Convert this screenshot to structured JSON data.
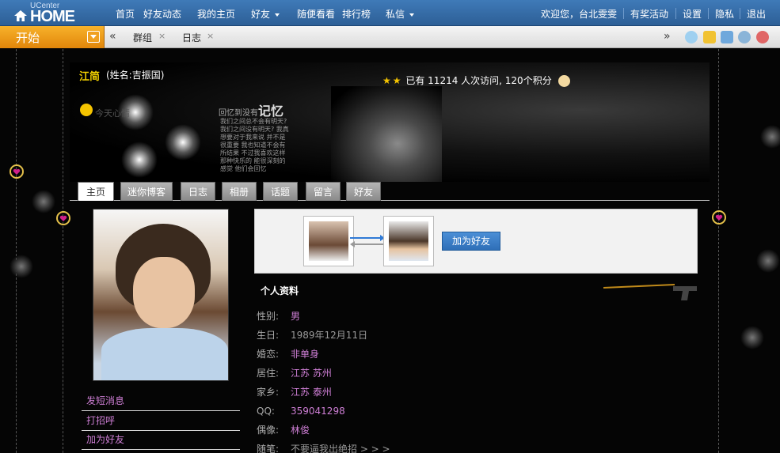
{
  "nav": {
    "logo_small": "UCenter",
    "logo_big": "HOME",
    "links": [
      "首页",
      "好友动态",
      "我的主页",
      "好友",
      "随便看看",
      "排行榜",
      "私信"
    ],
    "greeting": "欢迎您，台北雯雯",
    "right_links": [
      "有奖活动",
      "设置",
      "隐私",
      "退出"
    ]
  },
  "taskbar": {
    "start_label": "开始",
    "left_arrow": "«",
    "right_arrow": "»",
    "tabs": [
      "群组",
      "日志"
    ],
    "close_glyph": "×"
  },
  "banner": {
    "name": "江简",
    "realname": "(姓名:吉振国)",
    "mood": "今天心情",
    "visits": "已有 11214 人次访问, 120个积分",
    "memory_title_small": "回忆到没有",
    "memory_title_big": "记忆",
    "poem": "我们之间总不会有明天? 我们之间没有明天? 我真想要对于我来说 并不是很重要 我也知道不会有所结果 不过我喜欢这样 那种快乐的 能很深刻的感觉 他们会回忆"
  },
  "profile_tabs": [
    "主页",
    "迷你博客",
    "日志",
    "相册",
    "话题",
    "留言",
    "好友"
  ],
  "left_links": [
    "发短消息",
    "打招呼",
    "加为好友"
  ],
  "friend_box": {
    "add_button": "加为好友"
  },
  "info": {
    "title": "个人资料",
    "rows": [
      {
        "k": "性别:",
        "v": "男"
      },
      {
        "k": "生日:",
        "v": "1989年12月11日"
      },
      {
        "k": "婚恋:",
        "v": "非单身"
      },
      {
        "k": "居住:",
        "v": "江苏 苏州"
      },
      {
        "k": "家乡:",
        "v": "江苏 泰州"
      },
      {
        "k": "QQ:",
        "v": "359041298"
      },
      {
        "k": "偶像:",
        "v": "林俊"
      },
      {
        "k": "随笔:",
        "v": "不要逼我出绝招 > > >"
      }
    ]
  },
  "colors": {
    "nav_blue": "#3a72ae",
    "start_orange": "#f0a020",
    "link_pink": "#cf7fd6",
    "name_yellow": "#f2d000"
  }
}
